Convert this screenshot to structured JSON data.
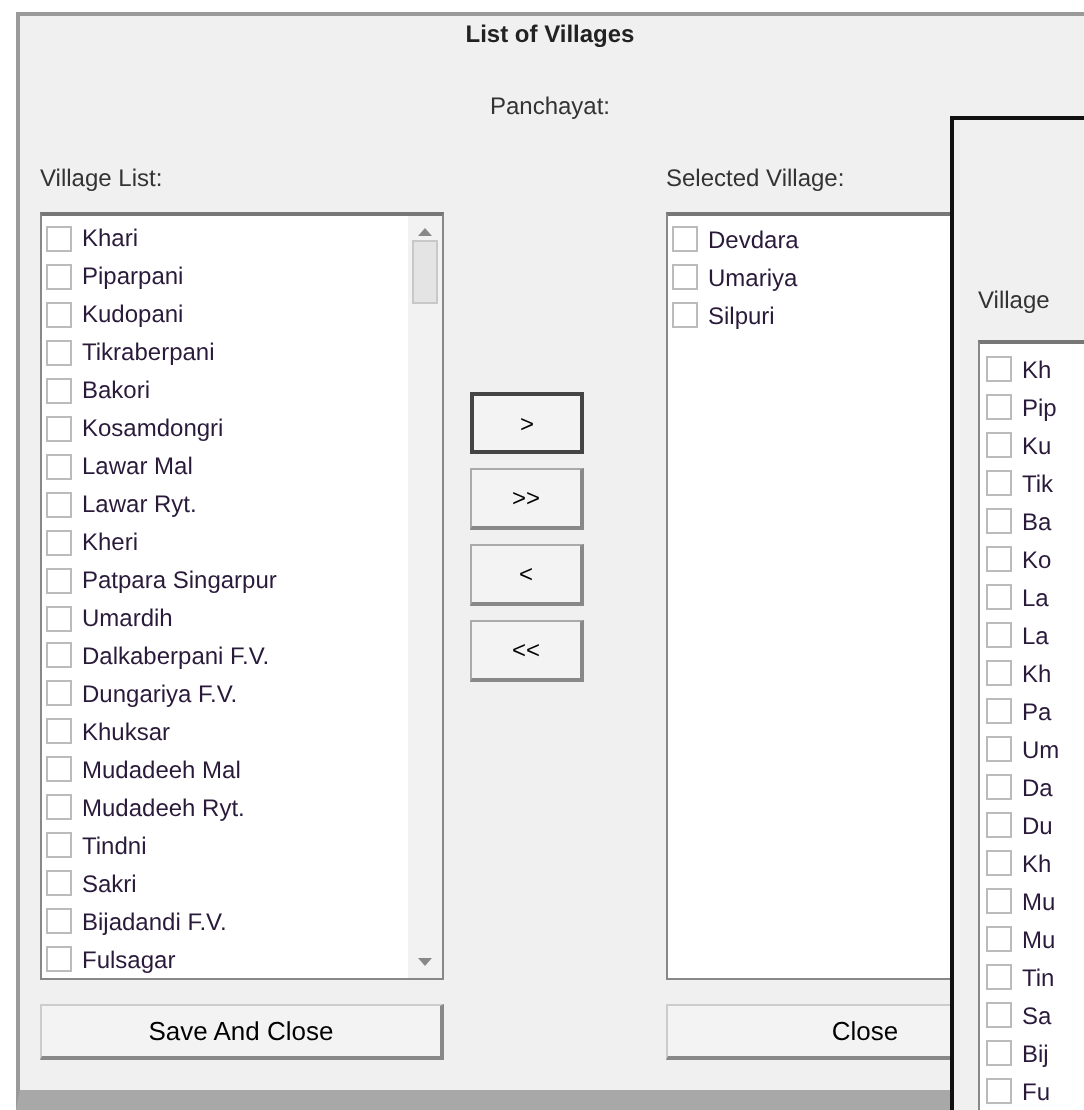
{
  "dialog": {
    "title": "List of Villages",
    "panchayat_label": "Panchayat:",
    "village_list_label": "Village List:",
    "selected_village_label": "Selected Village:",
    "village_list": [
      {
        "name": "Khari",
        "checked": false
      },
      {
        "name": "Piparpani",
        "checked": false
      },
      {
        "name": "Kudopani",
        "checked": false
      },
      {
        "name": "Tikraberpani",
        "checked": false
      },
      {
        "name": "Bakori",
        "checked": false
      },
      {
        "name": "Kosamdongri",
        "checked": false
      },
      {
        "name": "Lawar Mal",
        "checked": false
      },
      {
        "name": "Lawar Ryt.",
        "checked": false
      },
      {
        "name": "Kheri",
        "checked": false
      },
      {
        "name": "Patpara Singarpur",
        "checked": false
      },
      {
        "name": "Umardih",
        "checked": false
      },
      {
        "name": "Dalkaberpani F.V.",
        "checked": false
      },
      {
        "name": "Dungariya F.V.",
        "checked": false
      },
      {
        "name": "Khuksar",
        "checked": false
      },
      {
        "name": "Mudadeeh Mal",
        "checked": false
      },
      {
        "name": "Mudadeeh Ryt.",
        "checked": false
      },
      {
        "name": "Tindni",
        "checked": false
      },
      {
        "name": "Sakri",
        "checked": false
      },
      {
        "name": "Bijadandi F.V.",
        "checked": false
      },
      {
        "name": "Fulsagar",
        "checked": false
      }
    ],
    "move_buttons": [
      {
        "label": ">",
        "focused": true
      },
      {
        "label": ">>",
        "focused": false
      },
      {
        "label": "<",
        "focused": false
      },
      {
        "label": "<<",
        "focused": false
      }
    ],
    "selected_villages": [
      {
        "name": "Devdara",
        "checked": false
      },
      {
        "name": "Umariya",
        "checked": false
      },
      {
        "name": "Silpuri",
        "checked": false
      }
    ],
    "save_button": "Save And Close",
    "close_button": "Close"
  },
  "second_window": {
    "label": "Village",
    "items": [
      {
        "name": "Kh",
        "checked": false
      },
      {
        "name": "Pip",
        "checked": false
      },
      {
        "name": "Ku",
        "checked": false
      },
      {
        "name": "Tik",
        "checked": false
      },
      {
        "name": "Ba",
        "checked": false
      },
      {
        "name": "Ko",
        "checked": false
      },
      {
        "name": "La",
        "checked": false
      },
      {
        "name": "La",
        "checked": false
      },
      {
        "name": "Kh",
        "checked": false
      },
      {
        "name": "Pa",
        "checked": false
      },
      {
        "name": "Um",
        "checked": false
      },
      {
        "name": "Da",
        "checked": false
      },
      {
        "name": "Du",
        "checked": false
      },
      {
        "name": "Kh",
        "checked": false
      },
      {
        "name": "Mu",
        "checked": false
      },
      {
        "name": "Mu",
        "checked": false
      },
      {
        "name": "Tin",
        "checked": false
      },
      {
        "name": "Sa",
        "checked": false
      },
      {
        "name": "Bij",
        "checked": false
      },
      {
        "name": "Fu",
        "checked": false
      }
    ]
  }
}
